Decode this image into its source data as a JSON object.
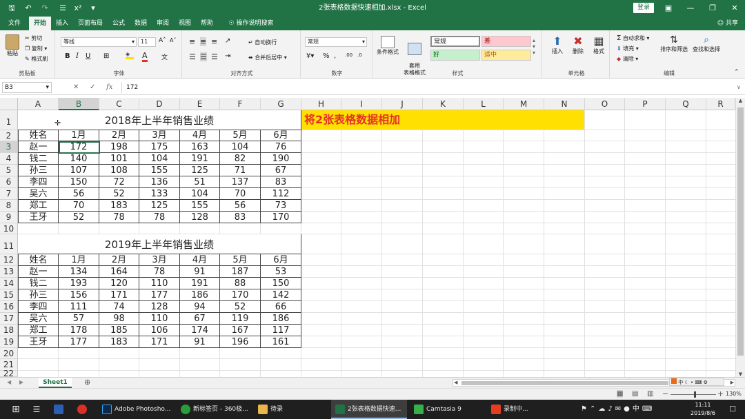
{
  "window": {
    "doc_title": "2张表格数据快速相加.xlsx - Excel",
    "login_label": "登录"
  },
  "menu": {
    "tabs": [
      "文件",
      "开始",
      "插入",
      "页面布局",
      "公式",
      "数据",
      "审阅",
      "视图",
      "帮助"
    ],
    "search_label": "操作说明搜索",
    "share_label": "共享"
  },
  "ribbon": {
    "clipboard": {
      "paste": "粘贴",
      "cut": "剪切",
      "copy": "复制",
      "format_painter": "格式刷",
      "label": "剪贴板"
    },
    "font": {
      "name": "等线",
      "size": "11",
      "label": "字体"
    },
    "alignment": {
      "wrap": "自动换行",
      "merge": "合并后居中",
      "label": "对齐方式"
    },
    "number": {
      "format": "常规",
      "label": "数字"
    },
    "styles": {
      "cond_format": "条件格式",
      "table_format": "套用\n表格格式",
      "normal": "常规",
      "bad": "差",
      "good": "好",
      "neutral": "适中",
      "label": "样式"
    },
    "cells": {
      "insert": "插入",
      "delete": "删除",
      "format": "格式",
      "label": "单元格"
    },
    "editing": {
      "autosum": "自动求和",
      "fill": "填充",
      "clear": "清除",
      "sort": "排序和筛选",
      "find": "查找和选择",
      "label": "编辑"
    }
  },
  "formula_bar": {
    "name_box": "B3",
    "fx": "fx",
    "value": "172"
  },
  "columns": [
    "A",
    "B",
    "C",
    "D",
    "E",
    "F",
    "G",
    "H",
    "I",
    "J",
    "K",
    "L",
    "M",
    "N",
    "O",
    "P",
    "Q",
    "R"
  ],
  "rows": [
    "1",
    "2",
    "3",
    "4",
    "5",
    "6",
    "7",
    "8",
    "9",
    "10",
    "11",
    "12",
    "13",
    "14",
    "15",
    "16",
    "17",
    "18",
    "19",
    "20",
    "21",
    "22"
  ],
  "banner_text": "将2张表格数据相加",
  "table1": {
    "title": "2018年上半年销售业绩",
    "headers": [
      "姓名",
      "1月",
      "2月",
      "3月",
      "4月",
      "5月",
      "6月"
    ],
    "rows": [
      [
        "赵一",
        "172",
        "198",
        "175",
        "163",
        "104",
        "76"
      ],
      [
        "钱二",
        "140",
        "101",
        "104",
        "191",
        "82",
        "190"
      ],
      [
        "孙三",
        "107",
        "108",
        "155",
        "125",
        "71",
        "67"
      ],
      [
        "李四",
        "150",
        "72",
        "136",
        "51",
        "137",
        "83"
      ],
      [
        "吴六",
        "56",
        "52",
        "133",
        "104",
        "70",
        "112"
      ],
      [
        "郑工",
        "70",
        "183",
        "125",
        "155",
        "56",
        "73"
      ],
      [
        "王牙",
        "52",
        "78",
        "78",
        "128",
        "83",
        "170"
      ]
    ]
  },
  "table2": {
    "title": "2019年上半年销售业绩",
    "headers": [
      "姓名",
      "1月",
      "2月",
      "3月",
      "4月",
      "5月",
      "6月"
    ],
    "rows": [
      [
        "赵一",
        "134",
        "164",
        "78",
        "91",
        "187",
        "53"
      ],
      [
        "钱二",
        "193",
        "120",
        "110",
        "191",
        "88",
        "150"
      ],
      [
        "孙三",
        "156",
        "171",
        "177",
        "186",
        "170",
        "142"
      ],
      [
        "李四",
        "111",
        "74",
        "128",
        "94",
        "52",
        "66"
      ],
      [
        "吴六",
        "57",
        "98",
        "110",
        "67",
        "119",
        "186"
      ],
      [
        "郑工",
        "178",
        "185",
        "106",
        "174",
        "167",
        "117"
      ],
      [
        "王牙",
        "177",
        "183",
        "171",
        "91",
        "196",
        "161"
      ]
    ]
  },
  "sheet_tab": "Sheet1",
  "zoom": "130%",
  "taskbar": {
    "apps": [
      "Adobe Photosho...",
      "新标签页 - 360极...",
      "待录",
      "2张表格数据快速...",
      "Camtasia 9",
      "录制中..."
    ],
    "time": "11:11",
    "date": "2019/8/6",
    "ime": "中"
  },
  "colors": {
    "excel_green": "#217346",
    "banner_yellow": "#ffe000",
    "banner_text": "#e5302a"
  }
}
